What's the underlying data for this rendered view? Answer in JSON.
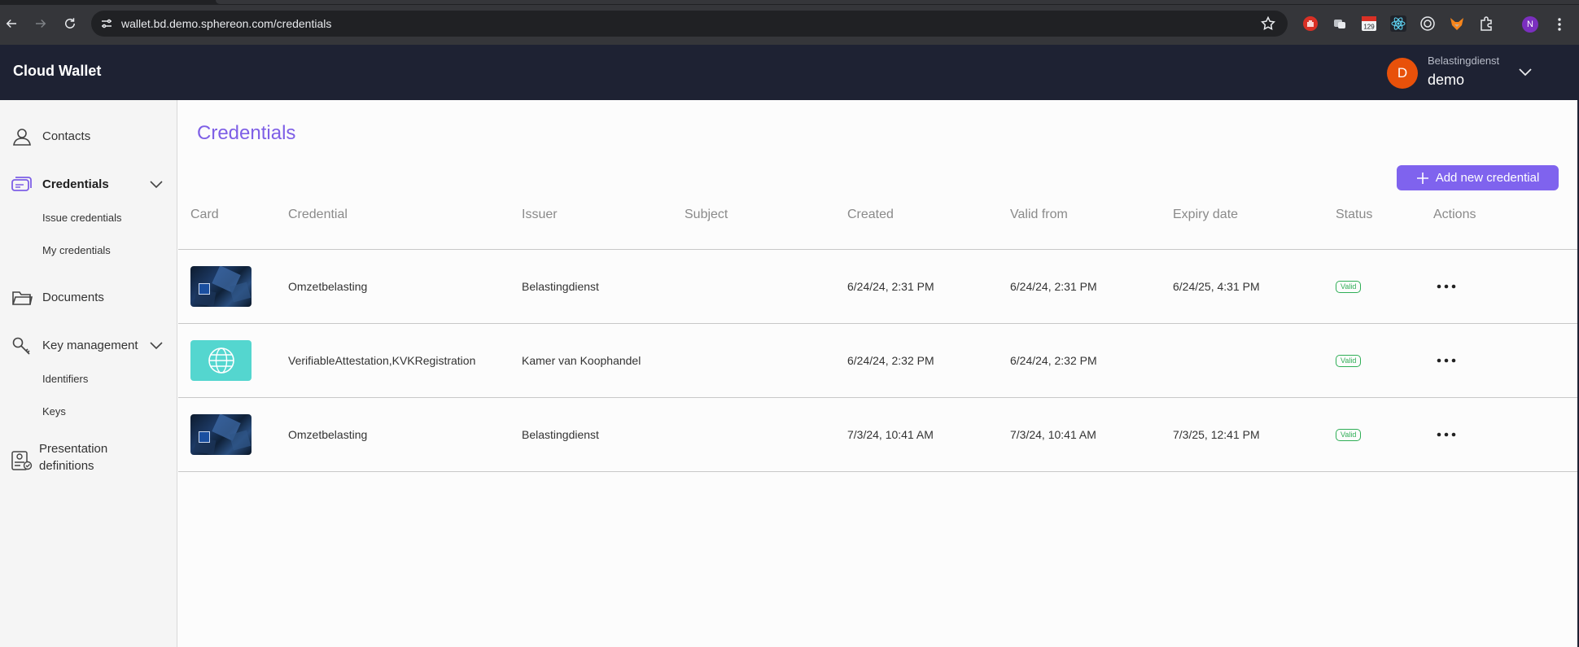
{
  "browser": {
    "url": "wallet.bd.demo.sphereon.com/credentials",
    "extensions": [
      "stop-hand-icon",
      "extension-icon",
      "calendar-icon",
      "react-icon",
      "target-icon",
      "fox-icon",
      "puzzle-icon"
    ],
    "calendar_badge": "129",
    "profile_initial": "N"
  },
  "app": {
    "brand": "Cloud Wallet",
    "user": {
      "initial": "D",
      "org": "Belastingdienst",
      "name": "demo"
    }
  },
  "sidebar": {
    "items": [
      {
        "label": "Contacts",
        "icon": "person-icon"
      },
      {
        "label": "Credentials",
        "icon": "cards-icon",
        "active": true,
        "children": [
          "Issue credentials",
          "My credentials"
        ]
      },
      {
        "label": "Documents",
        "icon": "folder-icon"
      },
      {
        "label": "Key management",
        "icon": "key-icon",
        "children": [
          "Identifiers",
          "Keys"
        ]
      },
      {
        "label_line1": "Presentation",
        "label_line2": "definitions",
        "icon": "presentation-icon"
      }
    ]
  },
  "main": {
    "title": "Credentials",
    "add_button": "Add new credential",
    "columns": [
      "Card",
      "Credential",
      "Issuer",
      "Subject",
      "Created",
      "Valid from",
      "Expiry date",
      "Status",
      "Actions"
    ],
    "rows": [
      {
        "card": "dark",
        "credential": "Omzetbelasting",
        "issuer": "Belastingdienst",
        "subject": "",
        "created": "6/24/24, 2:31 PM",
        "valid_from": "6/24/24, 2:31 PM",
        "expiry": "6/24/25, 4:31 PM",
        "status": "Valid"
      },
      {
        "card": "teal",
        "credential": "VerifiableAttestation,KVKRegistration",
        "issuer": "Kamer van Koophandel",
        "subject": "",
        "created": "6/24/24, 2:32 PM",
        "valid_from": "6/24/24, 2:32 PM",
        "expiry": "",
        "status": "Valid"
      },
      {
        "card": "dark",
        "credential": "Omzetbelasting",
        "issuer": "Belastingdienst",
        "subject": "",
        "created": "7/3/24, 10:41 AM",
        "valid_from": "7/3/24, 10:41 AM",
        "expiry": "7/3/25, 12:41 PM",
        "status": "Valid"
      }
    ]
  },
  "colors": {
    "accent": "#7f63ee",
    "header_bg": "#1e2233",
    "valid": "#2fae56",
    "avatar": "#e8510a"
  }
}
